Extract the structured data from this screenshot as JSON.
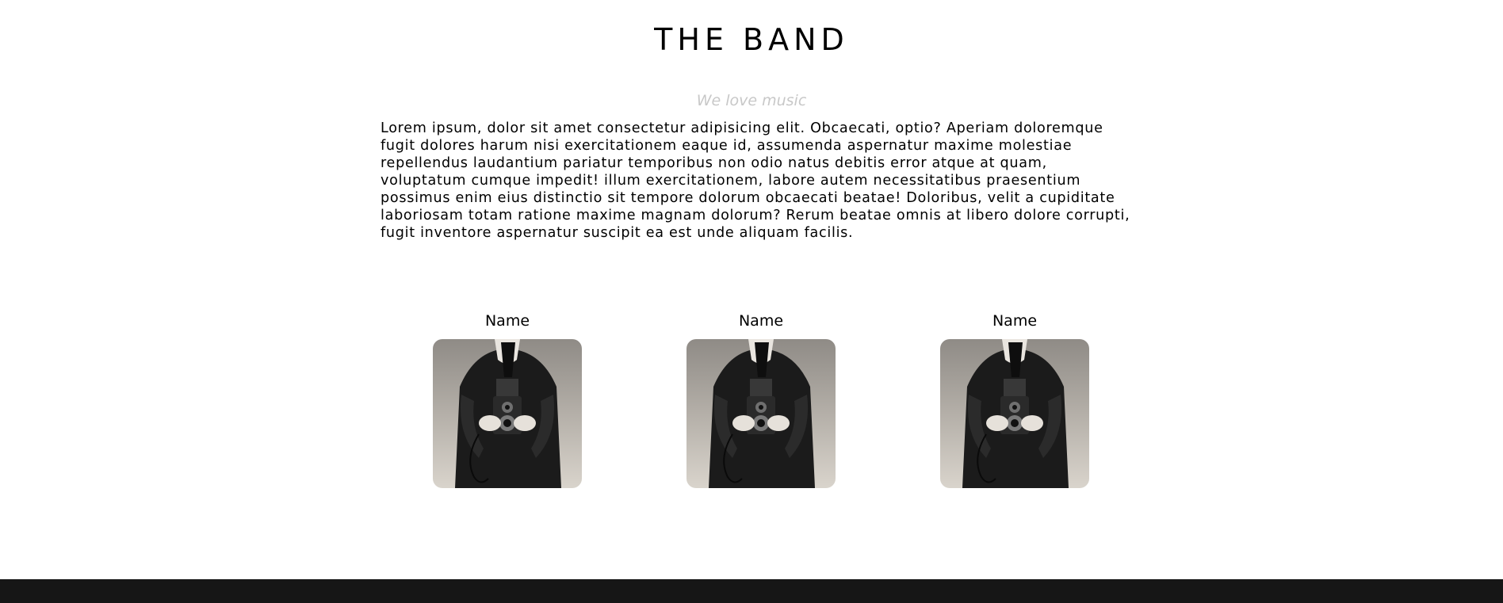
{
  "header": {
    "title": "THE BAND",
    "tagline": "We love music"
  },
  "intro": {
    "text": "Lorem ipsum, dolor sit amet consectetur adipisicing elit. Obcaecati, optio? Aperiam doloremque fugit dolores harum nisi exercitationem eaque id, assumenda aspernatur maxime molestiae repellendus laudantium pariatur temporibus non odio natus debitis error atque at quam, voluptatum cumque impedit! illum exercitationem, labore autem necessitatibus praesentium possimus enim eius distinctio sit tempore dolorum obcaecati beatae! Doloribus, velit a cupiditate laboriosam totam ratione maxime magnam dolorum? Rerum beatae omnis at libero dolore corrupti, fugit inventore aspernatur suscipit ea est unde aliquam facilis."
  },
  "members": [
    {
      "name": "Name"
    },
    {
      "name": "Name"
    },
    {
      "name": "Name"
    }
  ],
  "colors": {
    "background": "#ffffff",
    "tagline": "#c8c8c8",
    "footer": "#161616"
  }
}
